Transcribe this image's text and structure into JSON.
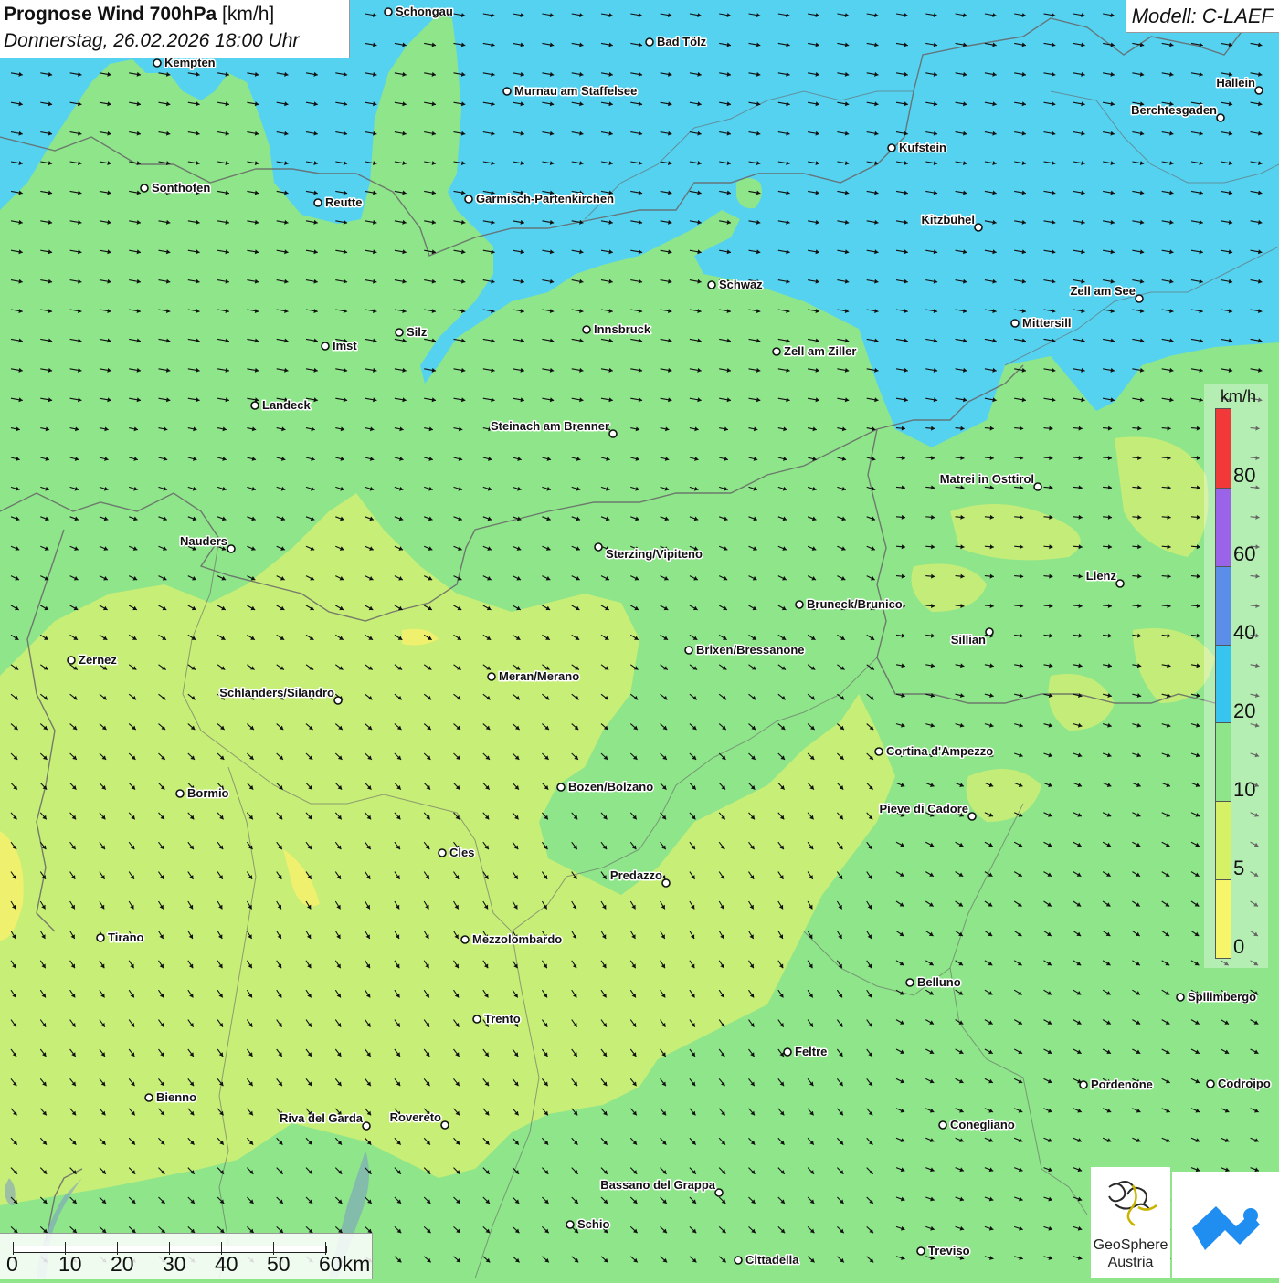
{
  "header": {
    "title_bold": "Prognose Wind 700hPa",
    "title_unit": "[km/h]",
    "datetime": "Donnerstag, 26.02.2026 18:00 Uhr"
  },
  "model": {
    "label": "Modell: C-LAEF"
  },
  "legend": {
    "unit": "km/h",
    "ticks": [
      "0",
      "5",
      "10",
      "20",
      "40",
      "60",
      "80"
    ],
    "colors": [
      "#f7f56a",
      "#d7f167",
      "#8ee58a",
      "#37c4ee",
      "#5b8ee8",
      "#9b63e7",
      "#f2393a"
    ]
  },
  "scalebar": {
    "ticks": [
      "0",
      "10",
      "20",
      "30",
      "40",
      "50",
      "60km"
    ]
  },
  "logos": {
    "geosphere_line1": "GeoSphere",
    "geosphere_line2": "Austria"
  },
  "cities": [
    {
      "name": "Schongau"
    },
    {
      "name": "Bad Tölz"
    },
    {
      "name": "Kempten"
    },
    {
      "name": "Murnau am Staffelsee"
    },
    {
      "name": "Hallein"
    },
    {
      "name": "Berchtesgaden"
    },
    {
      "name": "Kufstein"
    },
    {
      "name": "Sonthofen"
    },
    {
      "name": "Reutte"
    },
    {
      "name": "Garmisch-Partenkirchen"
    },
    {
      "name": "Kitzbühel"
    },
    {
      "name": "Schwaz"
    },
    {
      "name": "Zell am See"
    },
    {
      "name": "Innsbruck"
    },
    {
      "name": "Mittersill"
    },
    {
      "name": "Silz"
    },
    {
      "name": "Imst"
    },
    {
      "name": "Zell am Ziller"
    },
    {
      "name": "Landeck"
    },
    {
      "name": "Steinach am Brenner"
    },
    {
      "name": "Matrei in Osttirol"
    },
    {
      "name": "Nauders"
    },
    {
      "name": "Sterzing/Vipiteno"
    },
    {
      "name": "Lienz"
    },
    {
      "name": "Bruneck/Brunico"
    },
    {
      "name": "Sillian"
    },
    {
      "name": "Zernez"
    },
    {
      "name": "Brixen/Bressanone"
    },
    {
      "name": "Meran/Merano"
    },
    {
      "name": "Schlanders/Silandro"
    },
    {
      "name": "Cortina d'Ampezzo"
    },
    {
      "name": "Bozen/Bolzano"
    },
    {
      "name": "Bormio"
    },
    {
      "name": "Pieve di Cadore"
    },
    {
      "name": "Cles"
    },
    {
      "name": "Predazzo"
    },
    {
      "name": "Tirano"
    },
    {
      "name": "Mezzolombardo"
    },
    {
      "name": "Belluno"
    },
    {
      "name": "Spilimbergo"
    },
    {
      "name": "Trento"
    },
    {
      "name": "Feltre"
    },
    {
      "name": "Bienno"
    },
    {
      "name": "Pordenone"
    },
    {
      "name": "Codroipo"
    },
    {
      "name": "Riva del Garda"
    },
    {
      "name": "Rovereto"
    },
    {
      "name": "Conegliano"
    },
    {
      "name": "Bassano del Grappa"
    },
    {
      "name": "Schio"
    },
    {
      "name": "Treviso"
    },
    {
      "name": "Cittadella"
    }
  ]
}
